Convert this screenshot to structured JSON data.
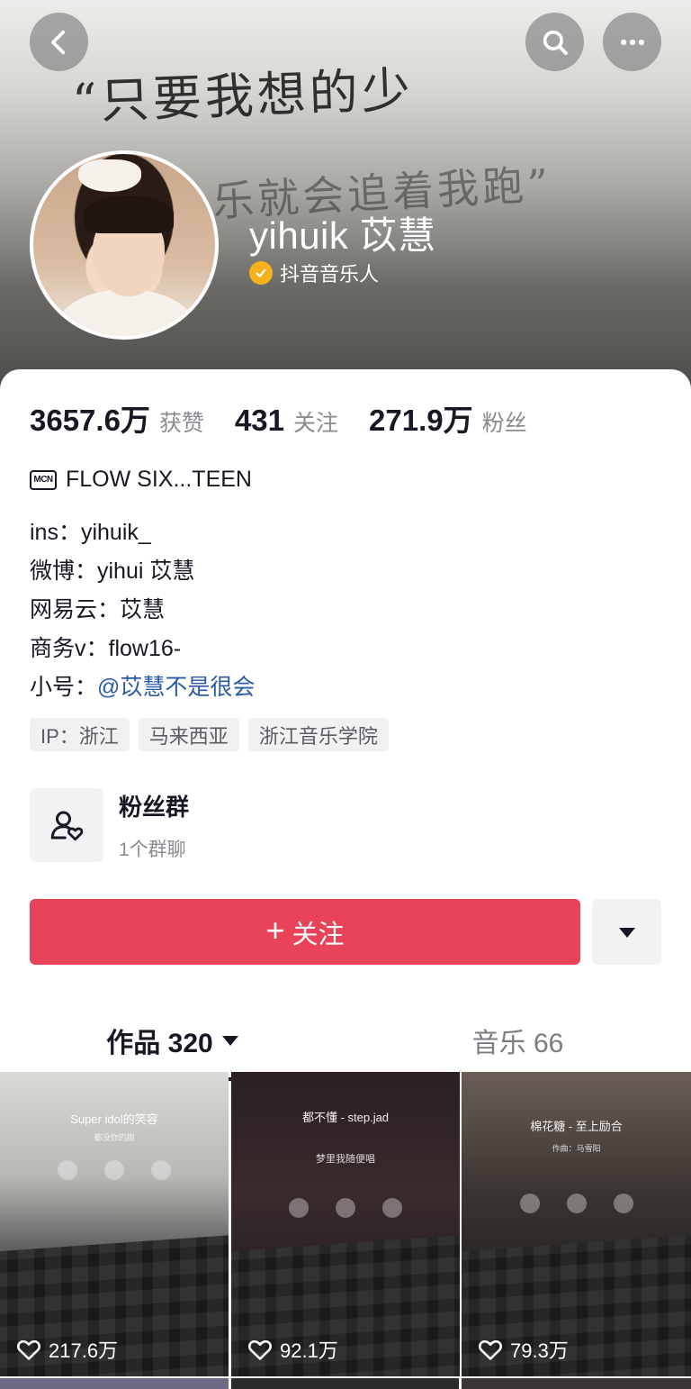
{
  "header": {
    "banner_text_line1": "“只要我想的少",
    "banner_text_line2": "乐就会追着我跑”",
    "name": "yihuik 苡慧",
    "verified_label": "抖音音乐人",
    "icons": [
      "back-icon",
      "search-icon",
      "more-icon"
    ]
  },
  "stats": [
    {
      "value": "3657.6万",
      "label": "获赞"
    },
    {
      "value": "431",
      "label": "关注"
    },
    {
      "value": "271.9万",
      "label": "粉丝"
    }
  ],
  "mcn": {
    "badge": "MCN",
    "text": "FLOW SIX...TEEN"
  },
  "bio": {
    "line1": "ins：yihuik_",
    "line2": "微博：yihui 苡慧",
    "line3": "网易云：苡慧",
    "line4": "商务v：flow16-",
    "line5_prefix": "小号：",
    "line5_link": "@苡慧不是很会"
  },
  "tags": [
    "IP：浙江",
    "马来西亚",
    "浙江音乐学院"
  ],
  "fan_group": {
    "title": "粉丝群",
    "subtitle": "1个群聊"
  },
  "follow_button": {
    "plus": "+",
    "label": "关注"
  },
  "tabs": {
    "works": "作品 320",
    "music": "音乐 66"
  },
  "videos": [
    {
      "caption": "Super idol的笑容",
      "sub": "都没你的甜",
      "likes": "217.6万"
    },
    {
      "caption": "都不懂 - step.jad",
      "sub": "梦里我随便唱",
      "likes": "92.1万"
    },
    {
      "caption": "棉花糖 - 至上励合",
      "sub": "作曲：马雪阳",
      "likes": "79.3万"
    }
  ],
  "colors": {
    "accent": "#e9435a",
    "link": "#2b5aa6",
    "verified": "#f5b21c"
  }
}
